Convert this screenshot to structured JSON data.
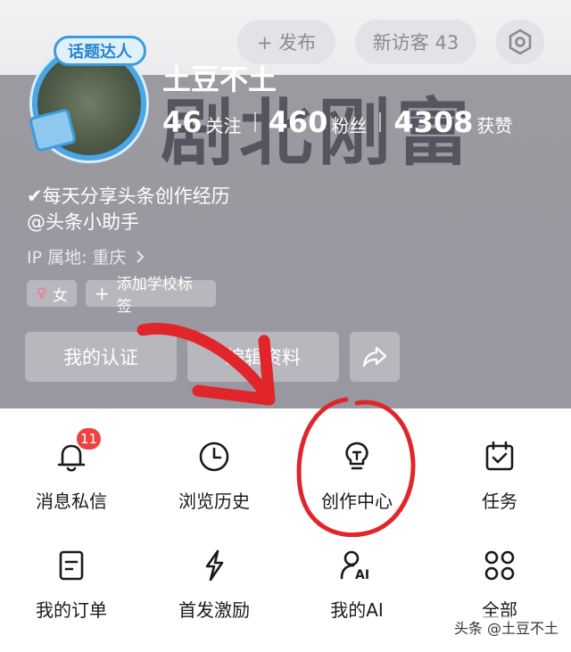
{
  "header": {
    "publish_label": "+ 发布",
    "visitors_label": "新访客 43"
  },
  "profile": {
    "avatar_badge": "话题达人",
    "username": "土豆不土",
    "background_text": "剧北刚富",
    "stats": [
      {
        "value": "46",
        "label": "关注"
      },
      {
        "value": "460",
        "label": "粉丝"
      },
      {
        "value": "4308",
        "label": "获赞"
      }
    ],
    "bio_line1": "✔每天分享头条创作经历",
    "bio_line2": "@头条小助手",
    "ip_label": "IP 属地: 重庆",
    "tags": {
      "gender": "女",
      "school": "添加学校标签"
    },
    "actions": {
      "certification": "我的认证",
      "edit_profile": "编辑资料"
    }
  },
  "menu": {
    "items": [
      {
        "label": "消息私信",
        "icon": "bell-icon",
        "badge": "11"
      },
      {
        "label": "浏览历史",
        "icon": "clock-icon"
      },
      {
        "label": "创作中心",
        "icon": "lightbulb-icon"
      },
      {
        "label": "任务",
        "icon": "calendar-check-icon"
      },
      {
        "label": "我的订单",
        "icon": "order-icon"
      },
      {
        "label": "首发激励",
        "icon": "lightning-icon"
      },
      {
        "label": "我的AI",
        "icon": "ai-icon"
      },
      {
        "label": "全部",
        "icon": "grid-icon"
      }
    ]
  },
  "watermark": "头条 @土豆不土",
  "colors": {
    "annotation_red": "#e0262b",
    "notification_red": "#f04142",
    "avatar_ring": "#4aa6e6"
  }
}
